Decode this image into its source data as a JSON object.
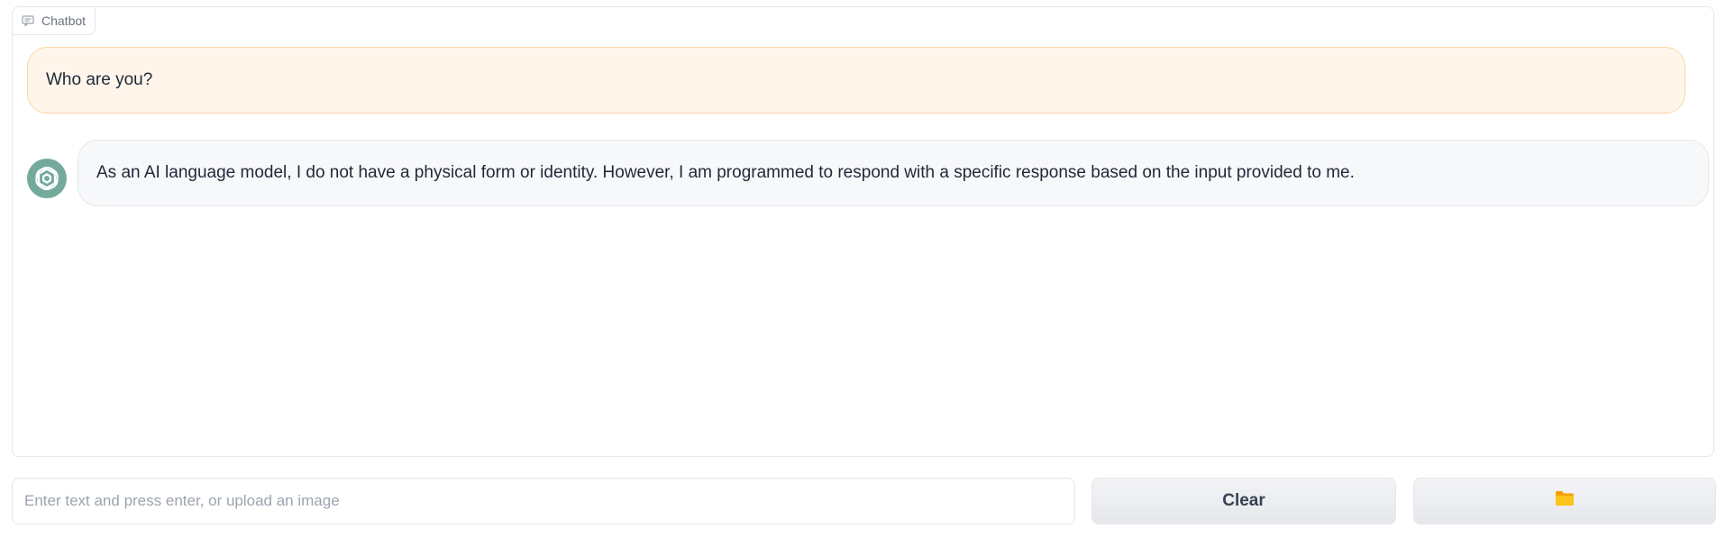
{
  "chatbot": {
    "label": "Chatbot",
    "messages": [
      {
        "role": "user",
        "text": "Who are you?"
      },
      {
        "role": "assistant",
        "text": "As an AI language model, I do not have a physical form or identity. However, I am programmed to respond with a specific response based on the input provided to me."
      }
    ]
  },
  "input": {
    "placeholder": "Enter text and press enter, or upload an image",
    "value": ""
  },
  "buttons": {
    "clear_label": "Clear",
    "upload_icon": "folder-icon"
  },
  "colors": {
    "user_bubble_bg": "#fff5ea",
    "user_bubble_border": "#fbd7a8",
    "bot_bubble_bg": "#f7f8fa",
    "avatar_bg": "#74aa9c",
    "folder_icon": "#fcc419"
  }
}
